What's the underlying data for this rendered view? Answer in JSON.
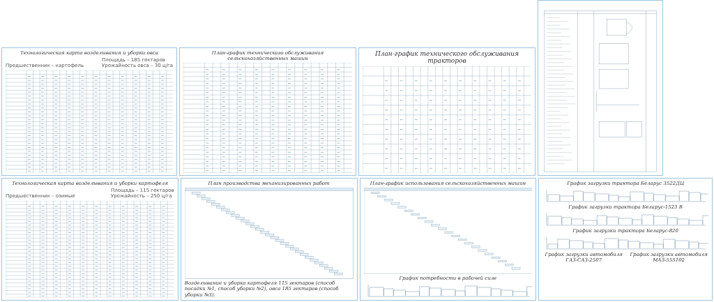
{
  "top_row": [
    {
      "kind": "tech_card",
      "title": "Технологическая карта возделывания и уборки овса",
      "notes": [
        "Предшественник – картофель",
        "Площадь – 185 гектаров",
        "Урожайность овса – 30 ц/га"
      ]
    },
    {
      "kind": "maintenance_table",
      "title": "План-график технического обслуживания сельскохозяйственных машин"
    },
    {
      "kind": "tractor_table",
      "title": "План-график технического обслуживания тракторов"
    },
    {
      "kind": "spec_sheet"
    }
  ],
  "bottom_row": [
    {
      "kind": "tech_card",
      "title": "Технологическая карта возделывания и уборки картофеля",
      "notes": [
        "Предшественник – озимые",
        "Площадь – 115 гектаров",
        "Урожайность – 250 ц/га"
      ]
    },
    {
      "kind": "gantt",
      "title": "План производства механизированных работ",
      "notes": [
        "Возделывание и уборка картофеля 115 гектаров (способ посадки №1, способ уборки №2), овса 185 гектаров (способ уборки №3)."
      ]
    },
    {
      "kind": "usage",
      "title": "План-график использования сельскохозяйственных машин",
      "subtitle": "График потребности в рабочей силе"
    },
    {
      "kind": "load_charts",
      "charts": [
        "График загрузки трактора Беларус 3522ДЦ",
        "График загрузки трактора Беларус-1523 В",
        "График загрузки трактора Беларус-820",
        "График загрузки автомобиля ГАЗ-САЗ-2507",
        "График загрузки автомобиля МАЗ-555102"
      ]
    }
  ]
}
